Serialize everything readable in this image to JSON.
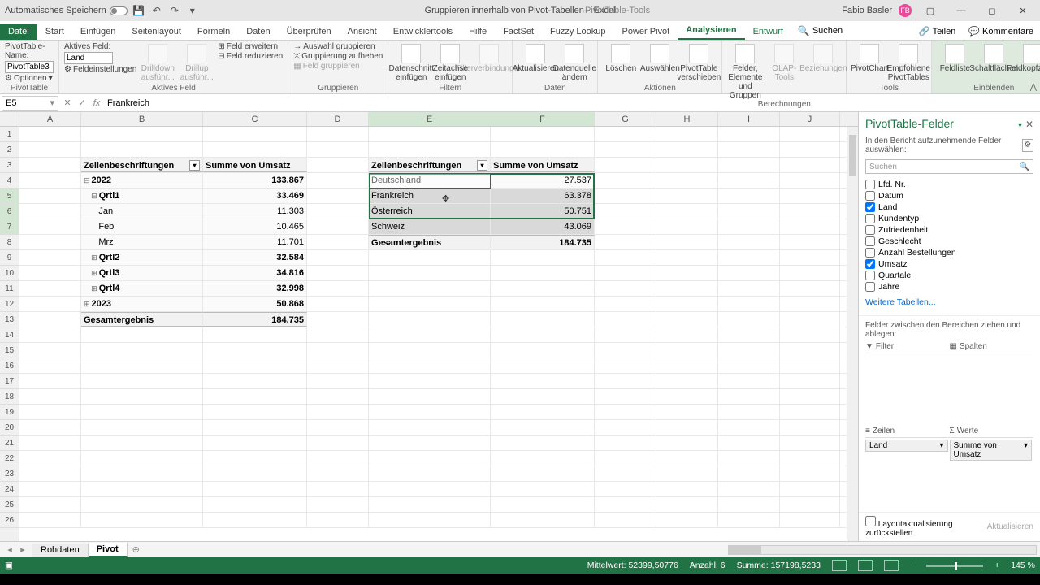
{
  "title": {
    "autosave": "Automatisches Speichern",
    "doc": "Gruppieren innerhalb von Pivot-Tabellen",
    "app": "Excel",
    "context_tool": "PivotTable-Tools",
    "user": "Fabio Basler",
    "avatar_initials": "FB"
  },
  "tabs": {
    "file": "Datei",
    "list": [
      "Start",
      "Einfügen",
      "Seitenlayout",
      "Formeln",
      "Daten",
      "Überprüfen",
      "Ansicht",
      "Entwicklertools",
      "Hilfe",
      "FactSet",
      "Fuzzy Lookup",
      "Power Pivot"
    ],
    "ctx": [
      "Analysieren",
      "Entwurf"
    ],
    "active_ctx": "Analysieren",
    "search_label": "Suchen",
    "share": "Teilen",
    "comments": "Kommentare"
  },
  "ribbon": {
    "g_pivot": {
      "label": "PivotTable",
      "name_lbl": "PivotTable-Name:",
      "name_val": "PivotTable3",
      "options": "Optionen"
    },
    "g_active": {
      "label": "Aktives Feld",
      "lbl": "Aktives Feld:",
      "val": "Land",
      "settings": "Feldeinstellungen",
      "drilldown": "Drilldown ausführ...",
      "drillup": "Drillup ausführ...",
      "expand": "Feld erweitern",
      "collapse": "Feld reduzieren"
    },
    "g_group": {
      "label": "Gruppieren",
      "sel": "Auswahl gruppieren",
      "ungroup": "Gruppierung aufheben",
      "groupfield": "Feld gruppieren"
    },
    "g_filter": {
      "label": "Filtern",
      "slicer": "Datenschnitt einfügen",
      "timeline": "Zeitachse einfügen",
      "conn": "Filterverbindungen"
    },
    "g_data": {
      "label": "Daten",
      "refresh": "Aktualisieren",
      "change": "Datenquelle ändern"
    },
    "g_actions": {
      "label": "Aktionen",
      "clear": "Löschen",
      "select": "Auswählen",
      "move": "PivotTable verschieben"
    },
    "g_calc": {
      "label": "Berechnungen",
      "fields": "Felder, Elemente und Gruppen",
      "olap": "OLAP-Tools",
      "rel": "Beziehungen"
    },
    "g_tools": {
      "label": "Tools",
      "chart": "PivotChart",
      "recommend": "Empfohlene PivotTables"
    },
    "g_show": {
      "label": "Einblenden",
      "fieldlist": "Feldliste",
      "buttons": "Schaltflächen",
      "headers": "Feldkopfzeilen"
    }
  },
  "fbar": {
    "name": "E5",
    "value": "Frankreich"
  },
  "cols": [
    "A",
    "B",
    "C",
    "D",
    "E",
    "F",
    "G",
    "H",
    "I",
    "J"
  ],
  "pivot1": {
    "hdr_row": "Zeilenbeschriftungen",
    "hdr_val": "Summe von Umsatz",
    "rows": [
      {
        "lbl": "2022",
        "val": "133.867",
        "exp": "-",
        "lvl": 0,
        "bold": true
      },
      {
        "lbl": "Qrtl1",
        "val": "33.469",
        "exp": "-",
        "lvl": 1,
        "bold": true
      },
      {
        "lbl": "Jan",
        "val": "11.303",
        "exp": "",
        "lvl": 2
      },
      {
        "lbl": "Feb",
        "val": "10.465",
        "exp": "",
        "lvl": 2
      },
      {
        "lbl": "Mrz",
        "val": "11.701",
        "exp": "",
        "lvl": 2
      },
      {
        "lbl": "Qrtl2",
        "val": "32.584",
        "exp": "+",
        "lvl": 1,
        "bold": true
      },
      {
        "lbl": "Qrtl3",
        "val": "34.816",
        "exp": "+",
        "lvl": 1,
        "bold": true
      },
      {
        "lbl": "Qrtl4",
        "val": "32.998",
        "exp": "+",
        "lvl": 1,
        "bold": true
      },
      {
        "lbl": "2023",
        "val": "50.868",
        "exp": "+",
        "lvl": 0,
        "bold": true
      }
    ],
    "total_lbl": "Gesamtergebnis",
    "total_val": "184.735"
  },
  "pivot2": {
    "hdr_row": "Zeilenbeschriftungen",
    "hdr_val": "Summe von Umsatz",
    "rows": [
      {
        "lbl": "Deutschland",
        "val": "27.537"
      },
      {
        "lbl": "Frankreich",
        "val": "63.378"
      },
      {
        "lbl": "Österreich",
        "val": "50.751"
      },
      {
        "lbl": "Schweiz",
        "val": "43.069"
      }
    ],
    "total_lbl": "Gesamtergebnis",
    "total_val": "184.735"
  },
  "pane": {
    "title": "PivotTable-Felder",
    "sub": "In den Bericht aufzunehmende Felder auswählen:",
    "search_ph": "Suchen",
    "fields": [
      {
        "name": "Lfd. Nr.",
        "ck": false
      },
      {
        "name": "Datum",
        "ck": false
      },
      {
        "name": "Land",
        "ck": true
      },
      {
        "name": "Kundentyp",
        "ck": false
      },
      {
        "name": "Zufriedenheit",
        "ck": false
      },
      {
        "name": "Geschlecht",
        "ck": false
      },
      {
        "name": "Anzahl Bestellungen",
        "ck": false
      },
      {
        "name": "Umsatz",
        "ck": true
      },
      {
        "name": "Quartale",
        "ck": false
      },
      {
        "name": "Jahre",
        "ck": false
      }
    ],
    "more": "Weitere Tabellen...",
    "dragtxt": "Felder zwischen den Bereichen ziehen und ablegen:",
    "area_filter": "Filter",
    "area_cols": "Spalten",
    "area_rows": "Zeilen",
    "area_vals": "Werte",
    "row_item": "Land",
    "val_item": "Summe von Umsatz",
    "defer": "Layoutaktualisierung zurückstellen",
    "update": "Aktualisieren"
  },
  "sheets": {
    "list": [
      "Rohdaten",
      "Pivot"
    ],
    "active": "Pivot"
  },
  "status": {
    "mean_lbl": "Mittelwert:",
    "mean": "52399,50776",
    "count_lbl": "Anzahl:",
    "count": "6",
    "sum_lbl": "Summe:",
    "sum": "157198,5233",
    "zoom": "145 %"
  }
}
